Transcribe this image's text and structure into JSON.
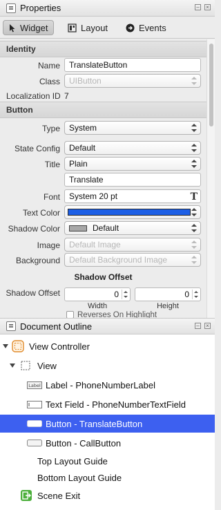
{
  "properties": {
    "title": "Properties",
    "tabs": [
      {
        "label": "Widget"
      },
      {
        "label": "Layout"
      },
      {
        "label": "Events"
      }
    ]
  },
  "identity": {
    "header": "Identity",
    "name_label": "Name",
    "name_value": "TranslateButton",
    "class_label": "Class",
    "class_placeholder": "UIButton",
    "localization_label": "Localization ID",
    "localization_value": "7"
  },
  "button": {
    "header": "Button",
    "type_label": "Type",
    "type_value": "System",
    "state_label": "State Config",
    "state_value": "Default",
    "title_label": "Title",
    "title_mode": "Plain",
    "title_text": "Translate",
    "font_label": "Font",
    "font_value": "System 20 pt",
    "text_color_label": "Text Color",
    "text_color": "#1d5fe6",
    "shadow_color_label": "Shadow Color",
    "shadow_color_value": "Default",
    "image_label": "Image",
    "image_placeholder": "Default Image",
    "background_label": "Background",
    "background_placeholder": "Default Background Image",
    "shadow_offset_header": "Shadow Offset",
    "shadow_offset_label": "Shadow Offset",
    "width_value": "0",
    "height_value": "0",
    "width_caption": "Width",
    "height_caption": "Height",
    "reverses_label": "Reverses On Highlight"
  },
  "outline": {
    "title": "Document Outline",
    "items": [
      {
        "label": "View Controller",
        "icon": "view-controller-icon"
      },
      {
        "label": "View",
        "icon": "view-icon"
      },
      {
        "label": "Label - PhoneNumberLabel",
        "icon": "label-icon"
      },
      {
        "label": "Text Field - PhoneNumberTextField",
        "icon": "text-field-icon"
      },
      {
        "label": "Button - TranslateButton",
        "icon": "button-icon",
        "selected": true
      },
      {
        "label": "Button - CallButton",
        "icon": "button-icon"
      },
      {
        "label": "Top Layout Guide"
      },
      {
        "label": "Bottom Layout Guide"
      },
      {
        "label": "Scene Exit",
        "icon": "scene-exit-icon"
      }
    ]
  },
  "colors": {
    "selection": "#3d60f0",
    "scene_exit": "#4caf3c",
    "view_controller": "#e08a2a"
  }
}
